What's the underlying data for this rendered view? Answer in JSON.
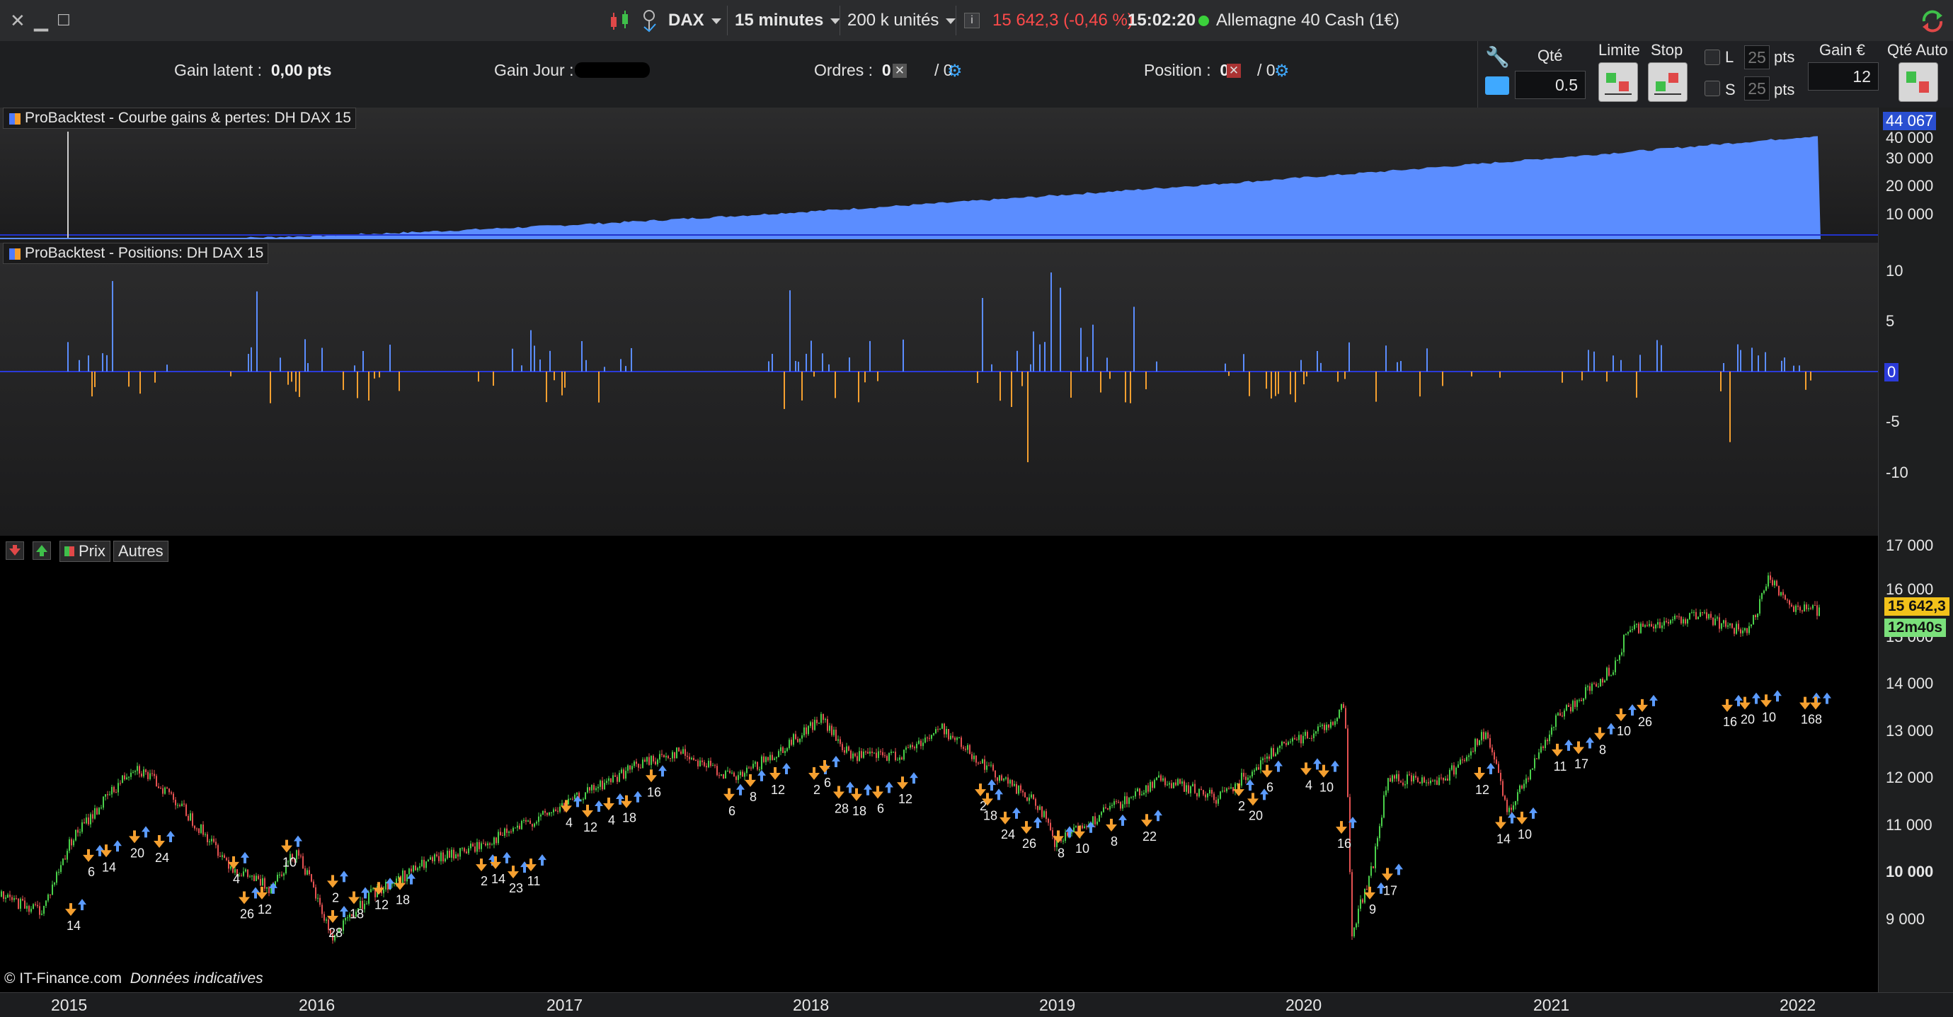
{
  "toolbar": {
    "instrument": "DAX",
    "timeframe": "15 minutes",
    "units": "200 k unités",
    "last_price": "15 642,3",
    "change": "(-0,46 %)",
    "time": "15:02:20",
    "market_name": "Allemagne 40 Cash (1€)",
    "colors": {
      "negative": "#ff4a4a",
      "market_open": "#3bd13b"
    }
  },
  "infobar": {
    "gain_latent_label": "Gain latent :",
    "gain_latent_value": "0,00 pts",
    "gain_jour_label": "Gain Jour :",
    "ordres_label": "Ordres :",
    "ordres_count_a": "0",
    "ordres_count_b": "/ 0",
    "position_label": "Position :",
    "position_count_a": "0",
    "position_count_b": "/ 0"
  },
  "order_panel": {
    "qty_label": "Qté",
    "qty_value": "0.5",
    "limit_label": "Limite",
    "stop_label": "Stop",
    "long_label": "L",
    "short_label": "S",
    "long_pts": "25",
    "short_pts": "25",
    "pts_label": "pts",
    "gain_label": "Gain €",
    "gain_value": "12",
    "qty_auto_label": "Qté Auto"
  },
  "equity_panel": {
    "title": "ProBacktest - Courbe gains & pertes: DH DAX 15",
    "current_value": "44 067",
    "ticks": [
      "40 000",
      "30 000",
      "20 000",
      "10 000"
    ],
    "color": "#5b8dff"
  },
  "positions_panel": {
    "title": "ProBacktest - Positions: DH DAX 15",
    "ticks": [
      "10",
      "5",
      "0",
      "-5",
      "-10"
    ],
    "colors": {
      "long": "#5b8dff",
      "short": "#f5a030"
    }
  },
  "price_panel": {
    "legend_price": "Prix",
    "legend_other": "Autres",
    "ticks": [
      "17 000",
      "16 000",
      "15 000",
      "14 000",
      "13 000",
      "12 000",
      "11 000",
      "10 000",
      "9 000"
    ],
    "last_price_tag": "15 642,3",
    "timer_tag": "12m40s",
    "copyright": "© IT-Finance.com",
    "data_note": "Données indicatives",
    "trade_counts": [
      "14",
      "6",
      "14",
      "20",
      "24",
      "4",
      "26",
      "12",
      "10",
      "2",
      "28",
      "18",
      "12",
      "18",
      "2",
      "14",
      "23",
      "11",
      "4",
      "12",
      "4",
      "18",
      "16",
      "6",
      "8",
      "12",
      "2",
      "6",
      "28",
      "18",
      "6",
      "12",
      "2",
      "18",
      "24",
      "26",
      "8",
      "10",
      "8",
      "22",
      "2",
      "6",
      "20",
      "4",
      "10",
      "16",
      "9",
      "17",
      "12",
      "14",
      "10",
      "11",
      "17",
      "8",
      "10",
      "26",
      "16",
      "20",
      "10",
      "16",
      "8"
    ]
  },
  "x_axis": [
    "2015",
    "2016",
    "2017",
    "2018",
    "2019",
    "2020",
    "2021",
    "2022"
  ]
}
